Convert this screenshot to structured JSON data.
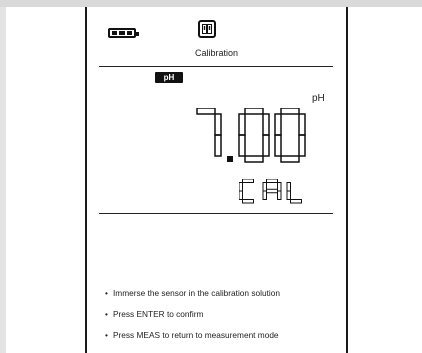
{
  "screen": {
    "title": "Calibration",
    "mode_badge": "pH",
    "unit": "pH",
    "value": "7.00",
    "status": "CAL",
    "instructions": [
      "Immerse the sensor in the calibration solution",
      "Press ENTER to confirm",
      "Press MEAS to return to measurement mode"
    ]
  },
  "indicators": {
    "battery_level": 1.0,
    "icons": [
      "battery-icon",
      "calibration-icon"
    ]
  },
  "colors": {
    "foreground": "#111111",
    "background": "#ffffff",
    "frame": "#d9d9d9"
  }
}
